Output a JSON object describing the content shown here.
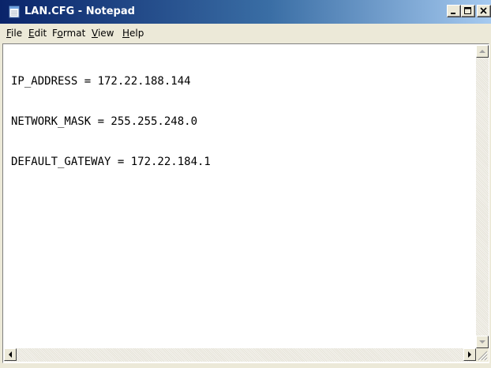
{
  "window": {
    "title": "LAN.CFG - Notepad",
    "icons": {
      "app": "notepad-icon",
      "minimize": "minimize-icon",
      "maximize": "maximize-icon",
      "close": "close-icon"
    },
    "colors": {
      "titlebar_start": "#0a246a",
      "titlebar_end": "#a6caf0",
      "chrome": "#ece9d8"
    }
  },
  "menu": {
    "items": [
      {
        "label_pre": "",
        "label_mnemonic": "F",
        "label_post": "ile"
      },
      {
        "label_pre": "",
        "label_mnemonic": "E",
        "label_post": "dit"
      },
      {
        "label_pre": "F",
        "label_mnemonic": "o",
        "label_post": "rmat"
      },
      {
        "label_pre": "",
        "label_mnemonic": "V",
        "label_post": "iew"
      },
      {
        "label_pre": "",
        "label_mnemonic": "H",
        "label_post": "elp"
      }
    ]
  },
  "editor": {
    "lines": [
      "IP_ADDRESS = 172.22.188.144",
      "NETWORK_MASK = 255.255.248.0",
      "DEFAULT_GATEWAY = 172.22.184.1"
    ]
  },
  "scrollbars": {
    "icons": {
      "up": "arrow-up-icon",
      "down": "arrow-down-icon",
      "left": "arrow-left-icon",
      "right": "arrow-right-icon",
      "grip": "resize-grip-icon"
    }
  }
}
